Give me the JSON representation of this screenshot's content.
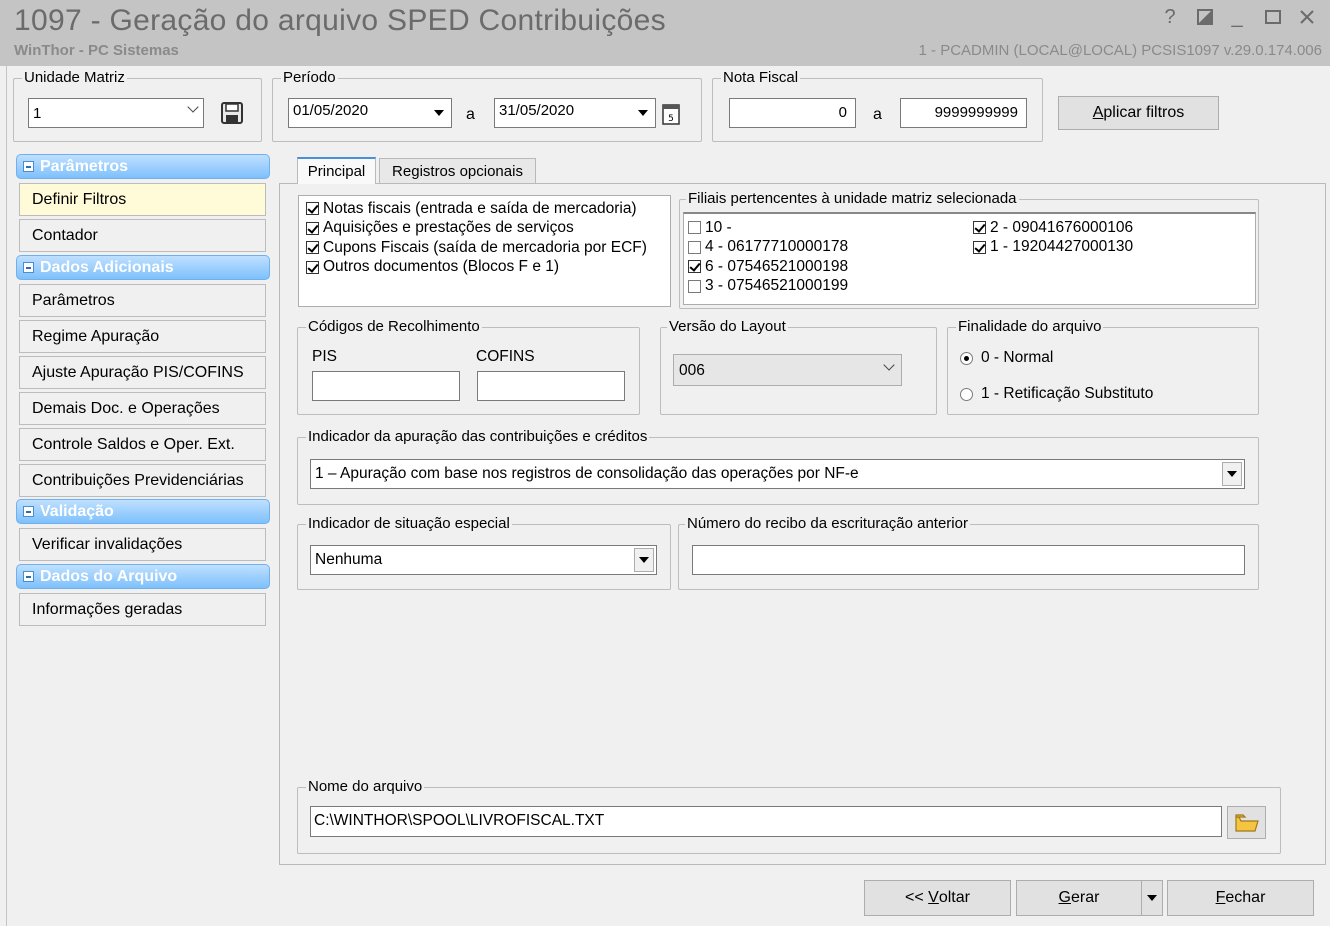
{
  "window": {
    "title": "1097 - Geração do arquivo SPED Contribuições",
    "subtitle": "WinThor - PC Sistemas",
    "user_info": "1 - PCADMIN (LOCAL@LOCAL)   PCSIS1097  v.29.0.174.006",
    "help_glyph": "?",
    "minimize_glyph": "_"
  },
  "unidade_matriz": {
    "legend": "Unidade Matriz",
    "value": "1"
  },
  "periodo": {
    "legend": "Período",
    "start": "01/05/2020",
    "separator": "a",
    "end": "31/05/2020"
  },
  "nota_fiscal": {
    "legend": "Nota Fiscal",
    "start": "0",
    "separator": "a",
    "end": "9999999999"
  },
  "apply_filters": {
    "label_pre": "A",
    "label_post": "plicar filtros"
  },
  "sidebar": {
    "sections": [
      {
        "title": "Parâmetros",
        "items": [
          "Definir Filtros",
          "Contador"
        ]
      },
      {
        "title": "Dados Adicionais",
        "items": [
          "Parâmetros",
          "Regime Apuração",
          "Ajuste Apuração PIS/COFINS",
          "Demais Doc. e Operações",
          "Controle Saldos e Oper. Ext.",
          "Contribuições Previdenciárias"
        ]
      },
      {
        "title": "Validação",
        "items": [
          "Verificar invalidações"
        ]
      },
      {
        "title": "Dados do Arquivo",
        "items": [
          "Informações geradas"
        ]
      }
    ]
  },
  "tabs": [
    "Principal",
    "Registros opcionais"
  ],
  "doc_types": [
    {
      "label": "Notas fiscais (entrada e saída de mercadoria)",
      "checked": true
    },
    {
      "label": "Aquisições e prestações de serviços",
      "checked": true
    },
    {
      "label": "Cupons Fiscais (saída de mercadoria por ECF)",
      "checked": true
    },
    {
      "label": "Outros documentos (Blocos F e 1)",
      "checked": true
    }
  ],
  "filiais": {
    "legend": "Filiais pertencentes à unidade matriz selecionada",
    "col1": [
      {
        "label": "10 -",
        "checked": false
      },
      {
        "label": "4 - 06177710000178",
        "checked": false
      },
      {
        "label": "6 - 07546521000198",
        "checked": true
      },
      {
        "label": "3 - 07546521000199",
        "checked": false
      }
    ],
    "col2": [
      {
        "label": "2 - 09041676000106",
        "checked": true
      },
      {
        "label": "1 - 19204427000130",
        "checked": true
      }
    ]
  },
  "codigos": {
    "legend": "Códigos de Recolhimento",
    "pis_label": "PIS",
    "cofins_label": "COFINS",
    "pis_value": "",
    "cofins_value": ""
  },
  "versao": {
    "legend": "Versão do Layout",
    "value": "006"
  },
  "finalidade": {
    "legend": "Finalidade do arquivo",
    "options": [
      {
        "label": "0 - Normal",
        "selected": true
      },
      {
        "label": "1 - Retificação Substituto",
        "selected": false
      }
    ]
  },
  "indicador_apuracao": {
    "legend": "Indicador da apuração das contribuições e créditos",
    "value": "1 – Apuração com base nos registros de consolidação das operações por NF-e"
  },
  "situacao_especial": {
    "legend": "Indicador de situação especial",
    "value": "Nenhuma"
  },
  "recibo": {
    "legend": "Número do recibo da escrituração anterior",
    "value": ""
  },
  "nome_arquivo": {
    "legend": "Nome do arquivo",
    "value": "C:\\WINTHOR\\SPOOL\\LIVROFISCAL.TXT"
  },
  "buttons": {
    "voltar_pre": "<< ",
    "voltar_u": "V",
    "voltar_post": "oltar",
    "gerar_u": "G",
    "gerar_post": "erar",
    "fechar_u": "F",
    "fechar_post": "echar"
  }
}
